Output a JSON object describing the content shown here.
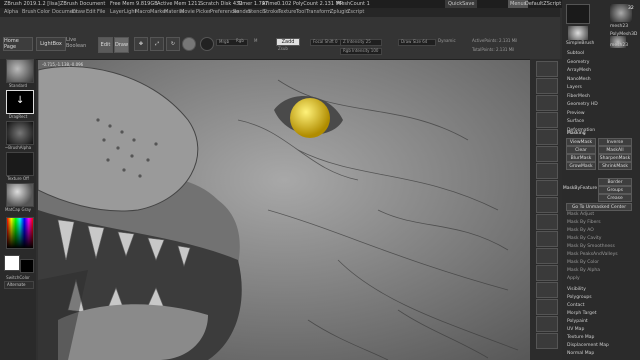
{
  "titlebar": {
    "app": "ZBrush 2019.1.2 [lisa]",
    "doc": "ZBrush Document",
    "free_mem": "Free Mem 9.819GB",
    "active_mem": "Active Mem 1211",
    "scratch": "Scratch Disk 432",
    "timer": "Timer 1.797",
    "atime": "ATime",
    "points": "0.102",
    "polycount": "PolyCount 2.131 MP",
    "meshcount": "MeshCount 1",
    "quicksave": "QuickSave",
    "menus": "Menus",
    "script": "DefaultZScript"
  },
  "menu": [
    "Alpha",
    "Brush",
    "Color",
    "Document",
    "Draw",
    "Edit",
    "File",
    "Layer",
    "Light",
    "Macro",
    "Marker",
    "Material",
    "Movie",
    "Picker",
    "Preferences",
    "Render",
    "Stencil",
    "Stroke",
    "Texture",
    "Tool",
    "Transform",
    "Zplugin",
    "Zscript"
  ],
  "toolbar": {
    "home": "Home Page",
    "lightbox": "LightBox",
    "live_boolean": "Live Boolean",
    "edit": "Edit",
    "draw": "Draw",
    "move": "Move",
    "scale": "Scale",
    "rotate": "Rotate",
    "mrgb": "Mrgb",
    "rgb": "Rgb",
    "m": "M",
    "zadd": "Zadd",
    "zsub": "Zsub",
    "zcut": "Zcut",
    "focal": "Focal Shift 0",
    "z_intensity": "Z Intensity 25",
    "rgb_intensity": "Rgb Intensity 100",
    "draw_size": "Draw Size 64",
    "dynamic": "Dynamic",
    "active_points": "ActivePoints: 2.131 Mil",
    "total_points": "TotalPoints: 2.131 Mil"
  },
  "leftshelf": {
    "brush": "Standard",
    "stroke": "DragRect",
    "alpha": "~BrushAlpha",
    "texture": "Texture Off",
    "material": "MatCap Gray",
    "gradient": "Gradient",
    "switch_color": "SwitchColor",
    "alternate": "Alternate"
  },
  "coords": "-0.715,-1.138,-0.096",
  "rightpanel": {
    "tool_thumbs": [
      "mesh23",
      "SimpleBrush",
      "PolyMesh3D",
      "mesh23"
    ],
    "count": "32",
    "sections_top": [
      "Subtool",
      "Geometry",
      "ArrayMesh",
      "NanoMesh",
      "Layers",
      "FiberMesh",
      "Geometry HD",
      "Preview",
      "Surface",
      "Deformation"
    ],
    "masking_title": "Masking",
    "mask_buttons": {
      "view_mask": "ViewMask",
      "inverse": "Inverse",
      "clear": "Clear",
      "mask_all": "MaskAll",
      "blur_mask": "BlurMask",
      "sharpen_mask": "SharpenMask",
      "grow_mask": "GrowMask",
      "shrink_mask": "ShrinkMask",
      "border": "Border",
      "mask_by_feature": "MaskByFeature",
      "groups": "Groups",
      "crease": "Crease",
      "go_to_unmasked": "Go To Unmasked Center"
    },
    "mask_items": [
      "Mask Adjust",
      "Mask By Fibers",
      "Mask By AO",
      "Mask By Cavity",
      "Mask By Smoothness",
      "Mask PeaksAndValleys",
      "Mask By Color",
      "Mask By Alpha",
      "Apply"
    ],
    "sections_bottom": [
      "Visibility",
      "Polygroups",
      "Contact",
      "Morph Target",
      "Polypaint",
      "UV Map",
      "Texture Map",
      "Displacement Map",
      "Normal Map"
    ]
  },
  "rightshelf": [
    "BPR",
    "SPix 3",
    "Scroll",
    "Zoom",
    "Actual",
    "AAHalf",
    "Persp",
    "Floor",
    "Local",
    "Frame",
    "Move",
    "ZoomD",
    "Rotate",
    "PolyF",
    "Transp",
    "Solo",
    "Xpose"
  ],
  "colors": {
    "accent": "#e08b1d",
    "eye": "#e6c400",
    "active_button": "#6a6a6a"
  }
}
